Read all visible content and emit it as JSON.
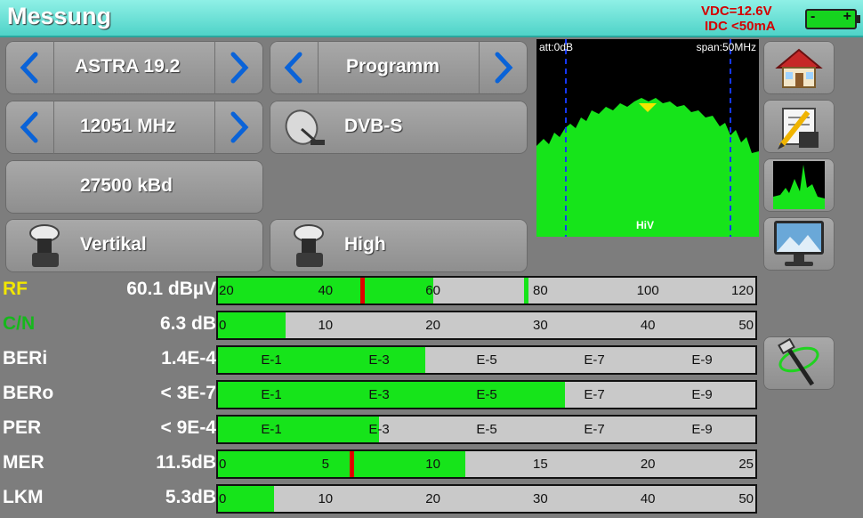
{
  "header": {
    "title": "Messung",
    "vdc": "VDC=12.6V",
    "idc": "IDC <50mA",
    "battery_minus": "-",
    "battery_plus": "+"
  },
  "controls": {
    "satellite": "ASTRA 19.2",
    "program": "Programm",
    "frequency": "12051 MHz",
    "standard": "DVB-S",
    "symbol_rate": "27500 kBd",
    "polarization": "Vertikal",
    "band": "High"
  },
  "spectrum": {
    "att": "att:0dB",
    "span": "span:50MHz",
    "band_label": "HiV"
  },
  "sidebar": [
    "home-icon",
    "save-edit-icon",
    "spectrum-icon",
    "monitor-icon",
    "tools-icon"
  ],
  "measurements": [
    {
      "label": "RF",
      "value": "60.1 dBµV",
      "label_color": "#f2e600",
      "fill": 0.4,
      "ticks": [
        "20",
        "40",
        "60",
        "80",
        "100",
        "120"
      ],
      "markers": [
        {
          "pos": 0.265,
          "color": "#e00000"
        },
        {
          "pos": 0.57,
          "color": "#16e41a"
        }
      ]
    },
    {
      "label": "C/N",
      "value": "6.3 dB",
      "label_color": "#16b81c",
      "fill": 0.125,
      "ticks": [
        "0",
        "10",
        "20",
        "30",
        "40",
        "50"
      ],
      "markers": []
    },
    {
      "label": "BERi",
      "value": "1.4E-4",
      "label_color": "#ffffff",
      "fill": 0.385,
      "ticks": [
        "E-1",
        "E-3",
        "E-5",
        "E-7",
        "E-9"
      ],
      "log": true,
      "markers": []
    },
    {
      "label": "BERo",
      "value": "< 3E-7",
      "label_color": "#ffffff",
      "fill": 0.645,
      "ticks": [
        "E-1",
        "E-3",
        "E-5",
        "E-7",
        "E-9"
      ],
      "log": true,
      "markers": []
    },
    {
      "label": "PER",
      "value": "< 9E-4",
      "label_color": "#ffffff",
      "fill": 0.3,
      "ticks": [
        "E-1",
        "E-3",
        "E-5",
        "E-7",
        "E-9"
      ],
      "log": true,
      "markers": []
    },
    {
      "label": "MER",
      "value": "11.5dB",
      "label_color": "#ffffff",
      "fill": 0.46,
      "ticks": [
        "0",
        "5",
        "10",
        "15",
        "20",
        "25"
      ],
      "markers": [
        {
          "pos": 0.245,
          "color": "#e00000"
        }
      ]
    },
    {
      "label": "LKM",
      "value": "5.3dB",
      "label_color": "#ffffff",
      "fill": 0.105,
      "ticks": [
        "0",
        "10",
        "20",
        "30",
        "40",
        "50"
      ],
      "markers": []
    }
  ]
}
